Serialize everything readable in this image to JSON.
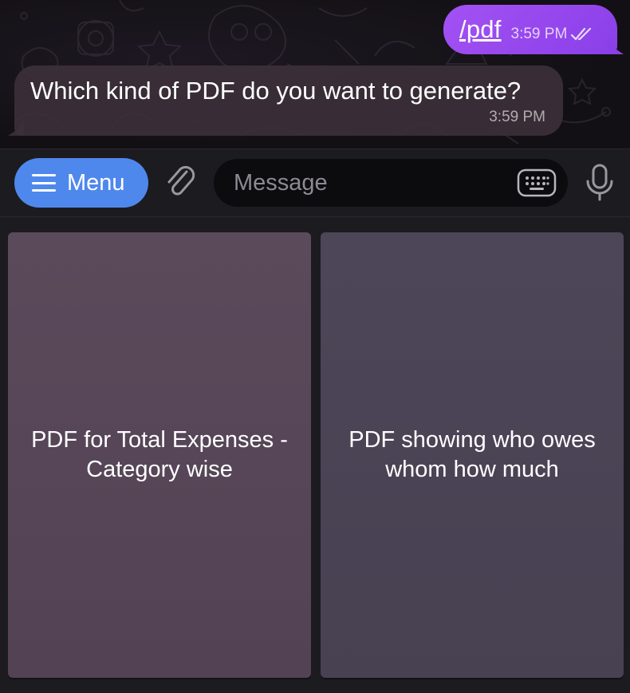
{
  "chat": {
    "outgoing": {
      "text": "/pdf",
      "time": "3:59 PM",
      "status_icon": "double-check-icon"
    },
    "incoming": {
      "text": "Which kind of PDF do you want to generate?",
      "time": "3:59 PM"
    }
  },
  "input_bar": {
    "menu_label": "Menu",
    "menu_icon": "hamburger-icon",
    "attach_icon": "paperclip-icon",
    "placeholder": "Message",
    "keyboard_icon": "keyboard-icon",
    "mic_icon": "microphone-icon"
  },
  "keyboard": {
    "buttons": [
      {
        "label": "PDF for Total Expenses - Category wise"
      },
      {
        "label": "PDF showing who owes whom how much"
      }
    ]
  },
  "colors": {
    "outgoing_bubble": "#9a4af0",
    "incoming_bubble": "#3c303a",
    "menu_button": "#4f88ec",
    "background": "#1c1b1f"
  }
}
